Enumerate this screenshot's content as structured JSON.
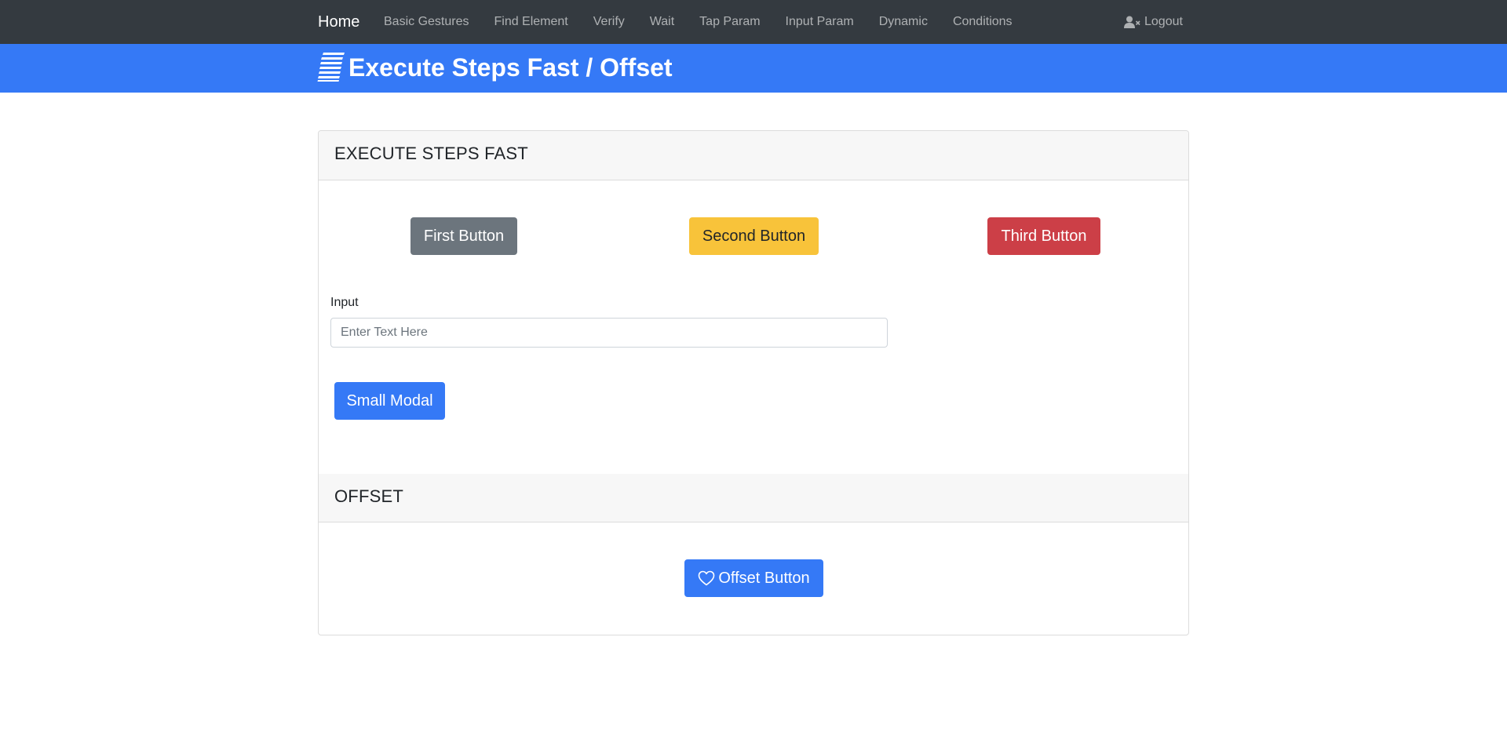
{
  "nav": {
    "home": "Home",
    "links": [
      "Basic Gestures",
      "Find Element",
      "Verify",
      "Wait",
      "Tap Param",
      "Input Param",
      "Dynamic",
      "Conditions"
    ],
    "logout": "Logout",
    "logout_icon": "user-times-icon"
  },
  "banner": {
    "icon": "stacked-lines-icon",
    "title": "Execute Steps Fast / Offset"
  },
  "section_fast": {
    "title": "EXECUTE STEPS FAST",
    "first_button": "First Button",
    "second_button": "Second Button",
    "third_button": "Third Button",
    "input_label": "Input",
    "input_placeholder": "Enter Text Here",
    "input_value": "",
    "modal_button": "Small Modal"
  },
  "section_offset": {
    "title": "OFFSET",
    "offset_button": "Offset Button",
    "offset_icon": "heart-icon"
  },
  "colors": {
    "navbar": "#343a40",
    "banner": "#3579f6",
    "primary": "#3579f6",
    "secondary": "#6c757d",
    "warning": "#f8c33a",
    "danger": "#cc3f47"
  }
}
